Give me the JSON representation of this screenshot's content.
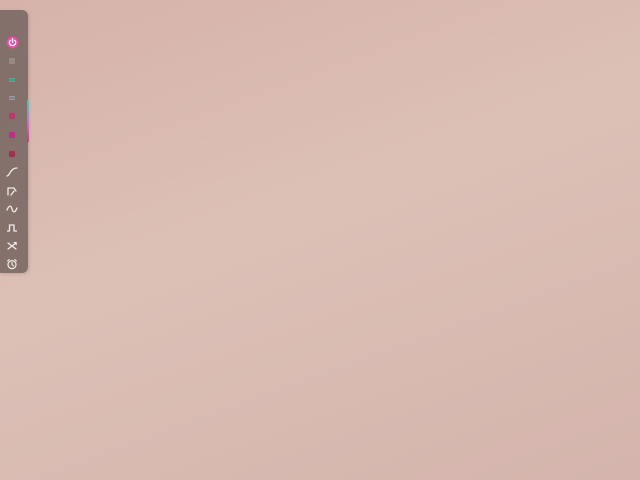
{
  "theme": {
    "background": "#dcc0b6",
    "toolbar_bg": "#786662",
    "power_color": "#e84aa8",
    "icon_color": "#f2ecea"
  },
  "toolbar": {
    "items": [
      {
        "icon": "power-icon"
      },
      {
        "icon": "palette-swatch-icon",
        "color": "#9a8a86"
      },
      {
        "icon": "palette-swatch-icon",
        "color": "#3ab89a"
      },
      {
        "icon": "palette-swatch-icon",
        "color": "#8fa0a8"
      },
      {
        "icon": "palette-swatch-icon",
        "color": "#b83a6a"
      },
      {
        "icon": "palette-swatch-icon",
        "color": "#c02a8a"
      },
      {
        "icon": "palette-swatch-icon",
        "color": "#a03050"
      },
      {
        "icon": "curve-ramp-icon"
      },
      {
        "icon": "curve-attack-icon"
      },
      {
        "icon": "sine-wave-icon"
      },
      {
        "icon": "square-wave-icon"
      },
      {
        "icon": "shuffle-cross-icon"
      },
      {
        "icon": "alarm-clock-icon"
      }
    ]
  }
}
